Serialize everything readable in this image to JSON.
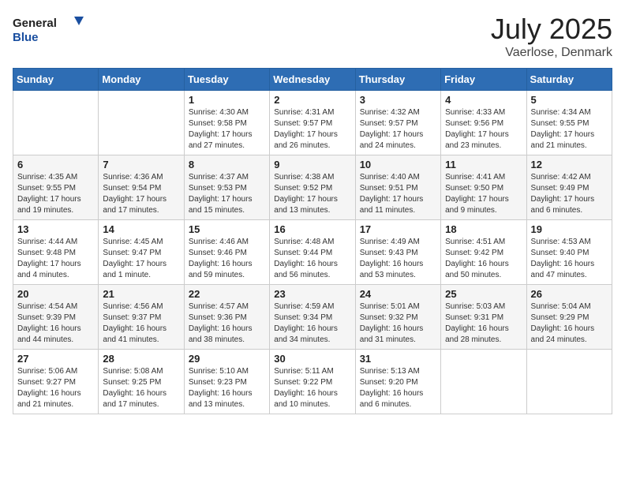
{
  "header": {
    "logo_general": "General",
    "logo_blue": "Blue",
    "title": "July 2025",
    "subtitle": "Vaerlose, Denmark"
  },
  "weekdays": [
    "Sunday",
    "Monday",
    "Tuesday",
    "Wednesday",
    "Thursday",
    "Friday",
    "Saturday"
  ],
  "weeks": [
    [
      {
        "day": "",
        "info": ""
      },
      {
        "day": "",
        "info": ""
      },
      {
        "day": "1",
        "info": "Sunrise: 4:30 AM\nSunset: 9:58 PM\nDaylight: 17 hours and 27 minutes."
      },
      {
        "day": "2",
        "info": "Sunrise: 4:31 AM\nSunset: 9:57 PM\nDaylight: 17 hours and 26 minutes."
      },
      {
        "day": "3",
        "info": "Sunrise: 4:32 AM\nSunset: 9:57 PM\nDaylight: 17 hours and 24 minutes."
      },
      {
        "day": "4",
        "info": "Sunrise: 4:33 AM\nSunset: 9:56 PM\nDaylight: 17 hours and 23 minutes."
      },
      {
        "day": "5",
        "info": "Sunrise: 4:34 AM\nSunset: 9:55 PM\nDaylight: 17 hours and 21 minutes."
      }
    ],
    [
      {
        "day": "6",
        "info": "Sunrise: 4:35 AM\nSunset: 9:55 PM\nDaylight: 17 hours and 19 minutes."
      },
      {
        "day": "7",
        "info": "Sunrise: 4:36 AM\nSunset: 9:54 PM\nDaylight: 17 hours and 17 minutes."
      },
      {
        "day": "8",
        "info": "Sunrise: 4:37 AM\nSunset: 9:53 PM\nDaylight: 17 hours and 15 minutes."
      },
      {
        "day": "9",
        "info": "Sunrise: 4:38 AM\nSunset: 9:52 PM\nDaylight: 17 hours and 13 minutes."
      },
      {
        "day": "10",
        "info": "Sunrise: 4:40 AM\nSunset: 9:51 PM\nDaylight: 17 hours and 11 minutes."
      },
      {
        "day": "11",
        "info": "Sunrise: 4:41 AM\nSunset: 9:50 PM\nDaylight: 17 hours and 9 minutes."
      },
      {
        "day": "12",
        "info": "Sunrise: 4:42 AM\nSunset: 9:49 PM\nDaylight: 17 hours and 6 minutes."
      }
    ],
    [
      {
        "day": "13",
        "info": "Sunrise: 4:44 AM\nSunset: 9:48 PM\nDaylight: 17 hours and 4 minutes."
      },
      {
        "day": "14",
        "info": "Sunrise: 4:45 AM\nSunset: 9:47 PM\nDaylight: 17 hours and 1 minute."
      },
      {
        "day": "15",
        "info": "Sunrise: 4:46 AM\nSunset: 9:46 PM\nDaylight: 16 hours and 59 minutes."
      },
      {
        "day": "16",
        "info": "Sunrise: 4:48 AM\nSunset: 9:44 PM\nDaylight: 16 hours and 56 minutes."
      },
      {
        "day": "17",
        "info": "Sunrise: 4:49 AM\nSunset: 9:43 PM\nDaylight: 16 hours and 53 minutes."
      },
      {
        "day": "18",
        "info": "Sunrise: 4:51 AM\nSunset: 9:42 PM\nDaylight: 16 hours and 50 minutes."
      },
      {
        "day": "19",
        "info": "Sunrise: 4:53 AM\nSunset: 9:40 PM\nDaylight: 16 hours and 47 minutes."
      }
    ],
    [
      {
        "day": "20",
        "info": "Sunrise: 4:54 AM\nSunset: 9:39 PM\nDaylight: 16 hours and 44 minutes."
      },
      {
        "day": "21",
        "info": "Sunrise: 4:56 AM\nSunset: 9:37 PM\nDaylight: 16 hours and 41 minutes."
      },
      {
        "day": "22",
        "info": "Sunrise: 4:57 AM\nSunset: 9:36 PM\nDaylight: 16 hours and 38 minutes."
      },
      {
        "day": "23",
        "info": "Sunrise: 4:59 AM\nSunset: 9:34 PM\nDaylight: 16 hours and 34 minutes."
      },
      {
        "day": "24",
        "info": "Sunrise: 5:01 AM\nSunset: 9:32 PM\nDaylight: 16 hours and 31 minutes."
      },
      {
        "day": "25",
        "info": "Sunrise: 5:03 AM\nSunset: 9:31 PM\nDaylight: 16 hours and 28 minutes."
      },
      {
        "day": "26",
        "info": "Sunrise: 5:04 AM\nSunset: 9:29 PM\nDaylight: 16 hours and 24 minutes."
      }
    ],
    [
      {
        "day": "27",
        "info": "Sunrise: 5:06 AM\nSunset: 9:27 PM\nDaylight: 16 hours and 21 minutes."
      },
      {
        "day": "28",
        "info": "Sunrise: 5:08 AM\nSunset: 9:25 PM\nDaylight: 16 hours and 17 minutes."
      },
      {
        "day": "29",
        "info": "Sunrise: 5:10 AM\nSunset: 9:23 PM\nDaylight: 16 hours and 13 minutes."
      },
      {
        "day": "30",
        "info": "Sunrise: 5:11 AM\nSunset: 9:22 PM\nDaylight: 16 hours and 10 minutes."
      },
      {
        "day": "31",
        "info": "Sunrise: 5:13 AM\nSunset: 9:20 PM\nDaylight: 16 hours and 6 minutes."
      },
      {
        "day": "",
        "info": ""
      },
      {
        "day": "",
        "info": ""
      }
    ]
  ]
}
